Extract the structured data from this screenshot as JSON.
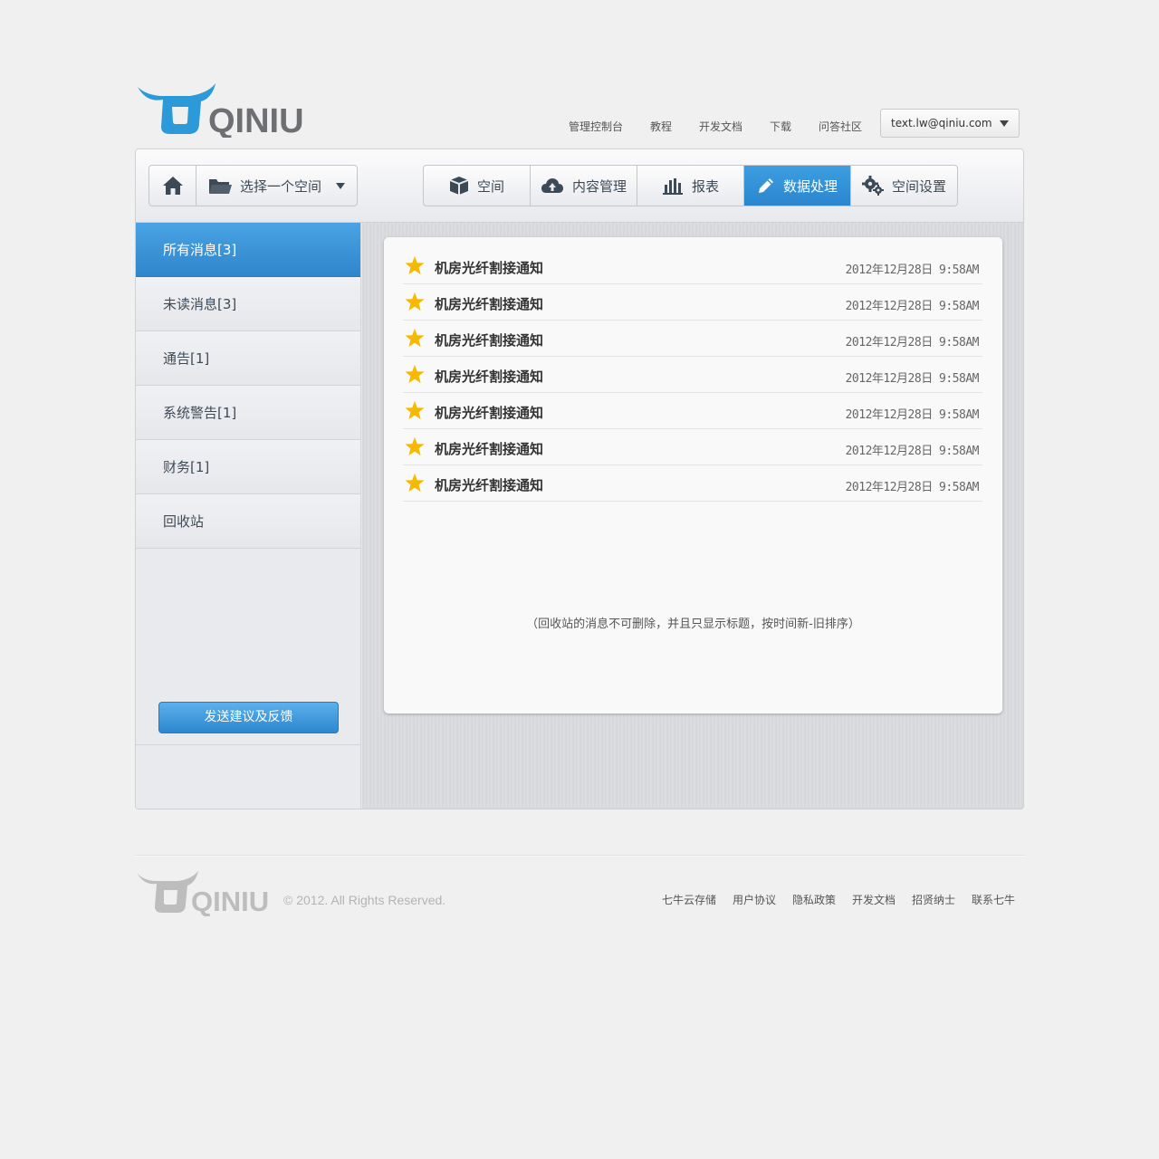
{
  "brand": {
    "logo_text": "QINIU",
    "accent": "#2a86cf"
  },
  "top_nav": [
    "管理控制台",
    "教程",
    "开发文档",
    "下载",
    "问答社区"
  ],
  "user": {
    "email": "text.lw@qiniu.com"
  },
  "toolbar": {
    "home_icon": "home-icon",
    "space_select": "选择一个空间",
    "tabs": [
      {
        "label": "空间",
        "icon": "box-icon"
      },
      {
        "label": "内容管理",
        "icon": "cloud-upload-icon"
      },
      {
        "label": "报表",
        "icon": "bar-chart-icon"
      },
      {
        "label": "数据处理",
        "icon": "pencil-icon",
        "active": true
      },
      {
        "label": "空间设置",
        "icon": "gears-icon"
      }
    ]
  },
  "sidebar": {
    "items": [
      {
        "label": "所有消息[3]",
        "active": true
      },
      {
        "label": "未读消息[3]"
      },
      {
        "label": "通告[1]"
      },
      {
        "label": "系统警告[1]"
      },
      {
        "label": "财务[1]"
      },
      {
        "label": "回收站"
      }
    ],
    "feedback_button": "发送建议及反馈"
  },
  "messages": [
    {
      "title": "机房光纤割接通知",
      "time": "2012年12月28日 9:58AM"
    },
    {
      "title": "机房光纤割接通知",
      "time": "2012年12月28日 9:58AM"
    },
    {
      "title": "机房光纤割接通知",
      "time": "2012年12月28日 9:58AM"
    },
    {
      "title": "机房光纤割接通知",
      "time": "2012年12月28日 9:58AM"
    },
    {
      "title": "机房光纤割接通知",
      "time": "2012年12月28日 9:58AM"
    },
    {
      "title": "机房光纤割接通知",
      "time": "2012年12月28日 9:58AM"
    },
    {
      "title": "机房光纤割接通知",
      "time": "2012年12月28日 9:58AM"
    }
  ],
  "note": "（回收站的消息不可删除，并且只显示标题，按时间新-旧排序）",
  "footer": {
    "logo_text": "QINIU",
    "copyright": "© 2012. All Rights Reserved.",
    "links": [
      "七牛云存储",
      "用户协议",
      "隐私政策",
      "开发文档",
      "招贤纳士",
      "联系七牛"
    ]
  }
}
